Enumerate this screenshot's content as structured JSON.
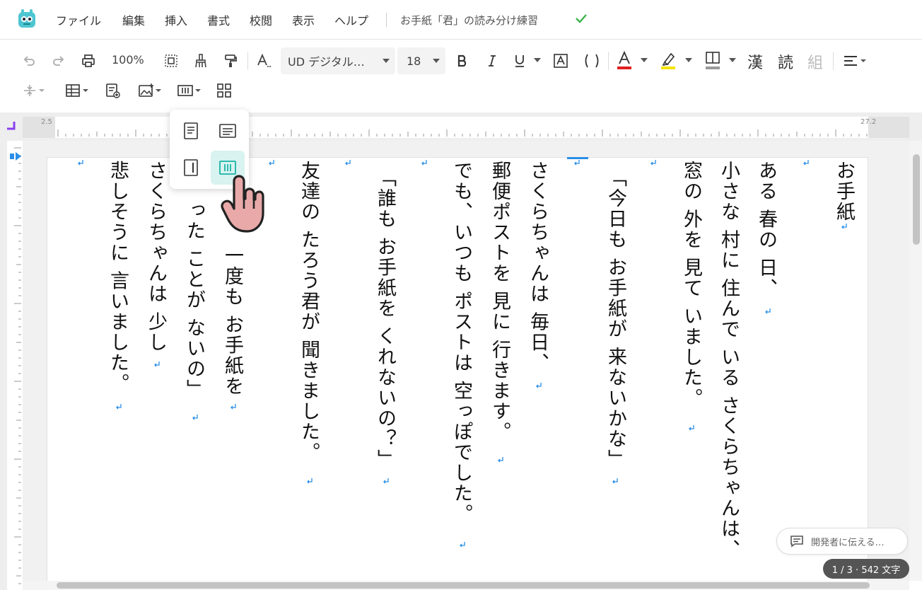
{
  "menu": {
    "items": [
      "ファイル",
      "編集",
      "挿入",
      "書式",
      "校閲",
      "表示",
      "ヘルプ"
    ],
    "doc_title": "お手紙「君」の読み分け練習"
  },
  "toolbar": {
    "zoom": "100%",
    "font_name": "UD デジタル…",
    "font_size": "18",
    "kanji_label": "漢",
    "read_label": "読",
    "kumi_label": "組"
  },
  "ruler": {
    "left_num": "2.5",
    "right_num": "27.2"
  },
  "document": {
    "columns": [
      "お手紙",
      "ある 春の 日、",
      "小さな 村に 住んで いる さくらちゃんは、",
      "窓の 外を 見て いました。",
      "「今日も お手紙が 来ないかな」",
      "さくらちゃんは 毎日、",
      "郵便ポストを 見に 行きます。",
      "でも、いつも ポストは 空っぽでした。",
      "「誰も お手紙を くれないの？」",
      "友達の たろう君が 聞きました。",
      "一度も お手紙を",
      "った ことが ないの」",
      "さくらちゃんは 少し",
      "悲しそうに 言いました。"
    ]
  },
  "feedback": {
    "label": "開発者に伝える…"
  },
  "status": {
    "text": "1 / 3 · 542 文字"
  },
  "colors": {
    "accent": "#19b3a6",
    "mark": "#2a8ee6",
    "ruler_marker": "#8a3ff0",
    "check": "#3cb34a"
  }
}
